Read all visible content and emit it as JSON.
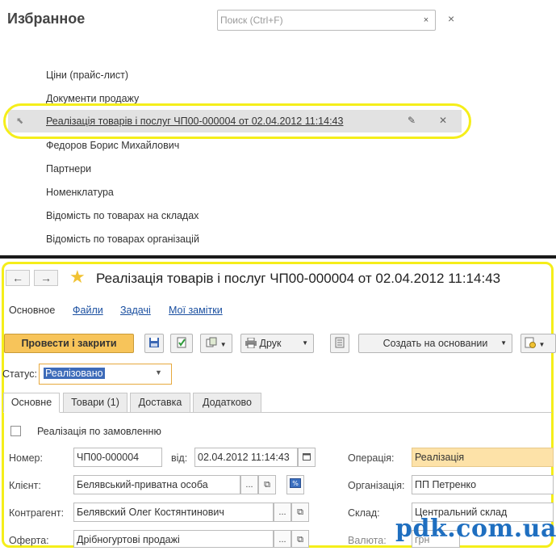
{
  "favorites": {
    "title": "Избранное",
    "search_placeholder": "Поиск (Ctrl+F)",
    "search_clear": "×",
    "close": "×",
    "items": [
      "Ціни (прайс-лист)",
      "Документи продажу",
      "Реалізація товарів і послуг ЧП00-000004 от 02.04.2012 11:14:43",
      "Федоров Борис Михайлович",
      "Партнери",
      "Номенклатура",
      "Відомість по товарах на складах",
      "Відомість по товарах організацій"
    ],
    "selected_index": 2
  },
  "document": {
    "title": "Реалізація товарів і послуг ЧП00-000004 от 02.04.2012 11:14:43",
    "nav": {
      "back": "←",
      "forward": "→"
    },
    "sections": [
      "Основное",
      "Файли",
      "Задачі",
      "Мої замітки"
    ],
    "toolbar": {
      "post_close": "Провести і закрити",
      "print": "Друк",
      "create_based_on": "Создать на основании"
    },
    "status": {
      "label": "Статус:",
      "value": "Реалізовано"
    },
    "tabs": [
      "Основне",
      "Товари (1)",
      "Доставка",
      "Додатково"
    ],
    "active_tab": 0,
    "by_order_label": "Реалізація по замовленню",
    "fields": {
      "number_label": "Номер:",
      "number": "ЧП00-000004",
      "date_label": "від:",
      "date": "02.04.2012 11:14:43",
      "operation_label": "Операція:",
      "operation": "Реалізація",
      "client_label": "Клієнт:",
      "client": "Белявський-приватна особа",
      "organization_label": "Організація:",
      "organization": "ПП Петренко",
      "counterparty_label": "Контрагент:",
      "counterparty": "Белявский Олег Костянтинович",
      "warehouse_label": "Склад:",
      "warehouse": "Центральний склад",
      "offer_label": "Оферта:",
      "offer": "Дрібногуртові продажі",
      "currency_label": "Валюта:",
      "currency": "грн"
    }
  },
  "watermark": "pdk.com.ua"
}
